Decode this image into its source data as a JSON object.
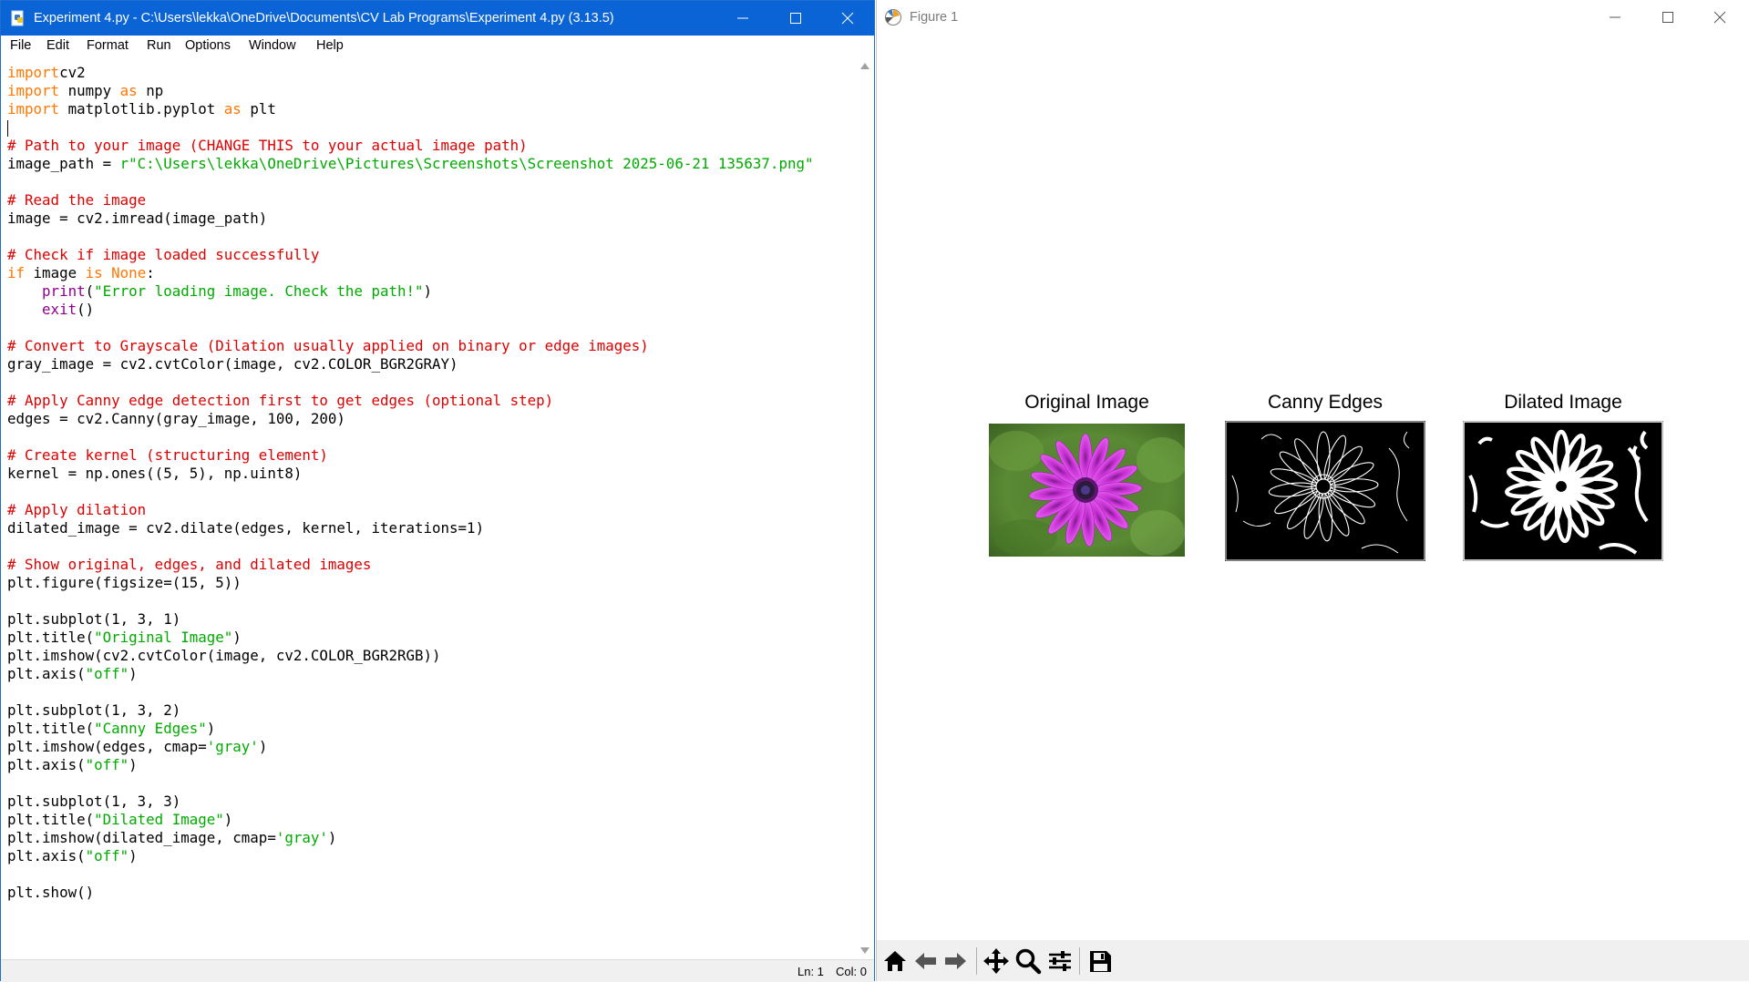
{
  "idle": {
    "title": "Experiment 4.py - C:\\Users\\lekka\\OneDrive\\Documents\\CV Lab Programs\\Experiment 4.py (3.13.5)",
    "menu": [
      "File",
      "Edit",
      "Format",
      "Run",
      "Options",
      "Window",
      "Help"
    ],
    "code": [
      [
        [
          "kw",
          "import"
        ],
        [
          "",
          "cv2"
        ]
      ],
      [
        [
          "kw",
          "import"
        ],
        [
          "",
          " numpy "
        ],
        [
          "kw",
          "as"
        ],
        [
          "",
          " np"
        ]
      ],
      [
        [
          "kw",
          "import"
        ],
        [
          "",
          " matplotlib.pyplot "
        ],
        [
          "kw",
          "as"
        ],
        [
          "",
          " plt"
        ]
      ],
      [],
      [
        [
          "cm",
          "# Path to your image (CHANGE THIS to your actual image path)"
        ]
      ],
      [
        [
          "",
          "image_path = "
        ],
        [
          "str",
          "r\"C:\\Users\\lekka\\OneDrive\\Pictures\\Screenshots\\Screenshot 2025-06-21 135637.png\""
        ]
      ],
      [],
      [
        [
          "cm",
          "# Read the image"
        ]
      ],
      [
        [
          "",
          "image = cv2.imread(image_path)"
        ]
      ],
      [],
      [
        [
          "cm",
          "# Check if image loaded successfully"
        ]
      ],
      [
        [
          "kw",
          "if"
        ],
        [
          "",
          " image "
        ],
        [
          "kw",
          "is"
        ],
        [
          "",
          " "
        ],
        [
          "kw",
          "None"
        ],
        [
          "",
          ":"
        ]
      ],
      [
        [
          "",
          "    "
        ],
        [
          "bi",
          "print"
        ],
        [
          "",
          "("
        ],
        [
          "str",
          "\"Error loading image. Check the path!\""
        ],
        [
          "",
          ")"
        ]
      ],
      [
        [
          "",
          "    "
        ],
        [
          "bi",
          "exit"
        ],
        [
          "",
          "()"
        ]
      ],
      [],
      [
        [
          "cm",
          "# Convert to Grayscale (Dilation usually applied on binary or edge images)"
        ]
      ],
      [
        [
          "",
          "gray_image = cv2.cvtColor(image, cv2.COLOR_BGR2GRAY)"
        ]
      ],
      [],
      [
        [
          "cm",
          "# Apply Canny edge detection first to get edges (optional step)"
        ]
      ],
      [
        [
          "",
          "edges = cv2.Canny(gray_image, 100, 200)"
        ]
      ],
      [],
      [
        [
          "cm",
          "# Create kernel (structuring element)"
        ]
      ],
      [
        [
          "",
          "kernel = np.ones((5, 5), np.uint8)"
        ]
      ],
      [],
      [
        [
          "cm",
          "# Apply dilation"
        ]
      ],
      [
        [
          "",
          "dilated_image = cv2.dilate(edges, kernel, iterations=1)"
        ]
      ],
      [],
      [
        [
          "cm",
          "# Show original, edges, and dilated images"
        ]
      ],
      [
        [
          "",
          "plt.figure(figsize=(15, 5))"
        ]
      ],
      [],
      [
        [
          "",
          "plt.subplot(1, 3, 1)"
        ]
      ],
      [
        [
          "",
          "plt.title("
        ],
        [
          "str",
          "\"Original Image\""
        ],
        [
          "",
          ")"
        ]
      ],
      [
        [
          "",
          "plt.imshow(cv2.cvtColor(image, cv2.COLOR_BGR2RGB))"
        ]
      ],
      [
        [
          "",
          "plt.axis("
        ],
        [
          "str",
          "\"off\""
        ],
        [
          "",
          ")"
        ]
      ],
      [],
      [
        [
          "",
          "plt.subplot(1, 3, 2)"
        ]
      ],
      [
        [
          "",
          "plt.title("
        ],
        [
          "str",
          "\"Canny Edges\""
        ],
        [
          "",
          ")"
        ]
      ],
      [
        [
          "",
          "plt.imshow(edges, cmap="
        ],
        [
          "str",
          "'gray'"
        ],
        [
          "",
          ")"
        ]
      ],
      [
        [
          "",
          "plt.axis("
        ],
        [
          "str",
          "\"off\""
        ],
        [
          "",
          ")"
        ]
      ],
      [],
      [
        [
          "",
          "plt.subplot(1, 3, 3)"
        ]
      ],
      [
        [
          "",
          "plt.title("
        ],
        [
          "str",
          "\"Dilated Image\""
        ],
        [
          "",
          ")"
        ]
      ],
      [
        [
          "",
          "plt.imshow(dilated_image, cmap="
        ],
        [
          "str",
          "'gray'"
        ],
        [
          "",
          ")"
        ]
      ],
      [
        [
          "",
          "plt.axis("
        ],
        [
          "str",
          "\"off\""
        ],
        [
          "",
          ")"
        ]
      ],
      [],
      [
        [
          "",
          "plt.show()"
        ]
      ]
    ],
    "status": {
      "line": "Ln: 1",
      "col": "Col: 0"
    }
  },
  "figure": {
    "title": "Figure 1",
    "subplots": [
      {
        "title": "Original Image"
      },
      {
        "title": "Canny Edges"
      },
      {
        "title": "Dilated Image"
      }
    ],
    "toolbar": [
      "home-icon",
      "back-icon",
      "forward-icon",
      "pan-icon",
      "zoom-icon",
      "configure-subplots-icon",
      "save-icon"
    ]
  },
  "colors": {
    "idle_titlebar": "#0a64d6",
    "keyword": "#ff7700",
    "builtin": "#900090",
    "string": "#00aa00",
    "comment": "#dd0000"
  }
}
